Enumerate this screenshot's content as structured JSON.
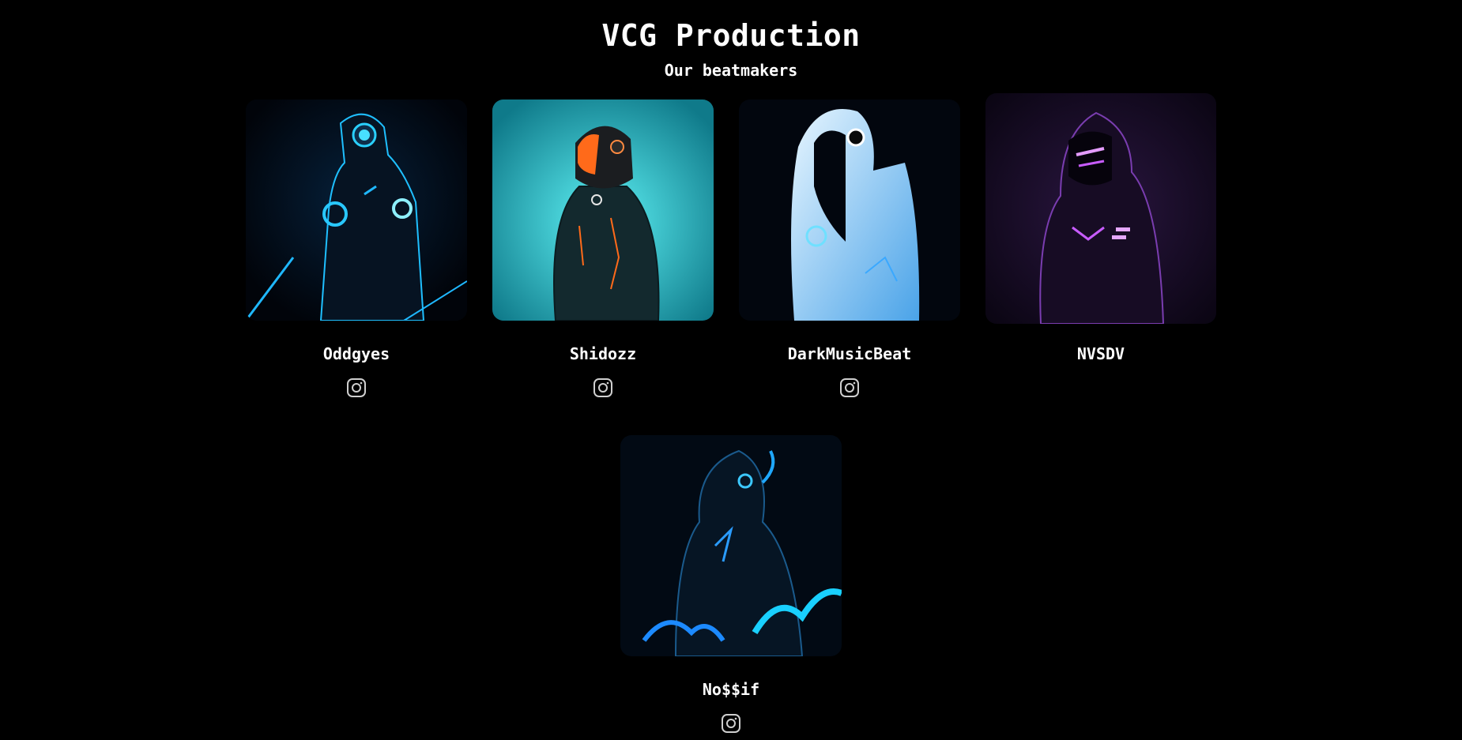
{
  "header": {
    "title": "VCG Production",
    "subtitle": "Our beatmakers"
  },
  "beatmakers": [
    {
      "name": "Oddgyes",
      "accent": "#19c8ff",
      "background": "#02070f",
      "has_instagram": true
    },
    {
      "name": "Shidozz",
      "accent": "#ff6a1a",
      "background": "#22c9d6",
      "has_instagram": true
    },
    {
      "name": "DarkMusicBeat",
      "accent": "#9fdcff",
      "background": "#030812",
      "has_instagram": true
    },
    {
      "name": "NVSDV",
      "accent": "#c85cff",
      "background": "#0d0618",
      "has_instagram": false
    },
    {
      "name": "No$$if",
      "accent": "#17b4ff",
      "background": "#020a14",
      "has_instagram": true
    }
  ],
  "icons": {
    "social": "instagram-icon"
  }
}
